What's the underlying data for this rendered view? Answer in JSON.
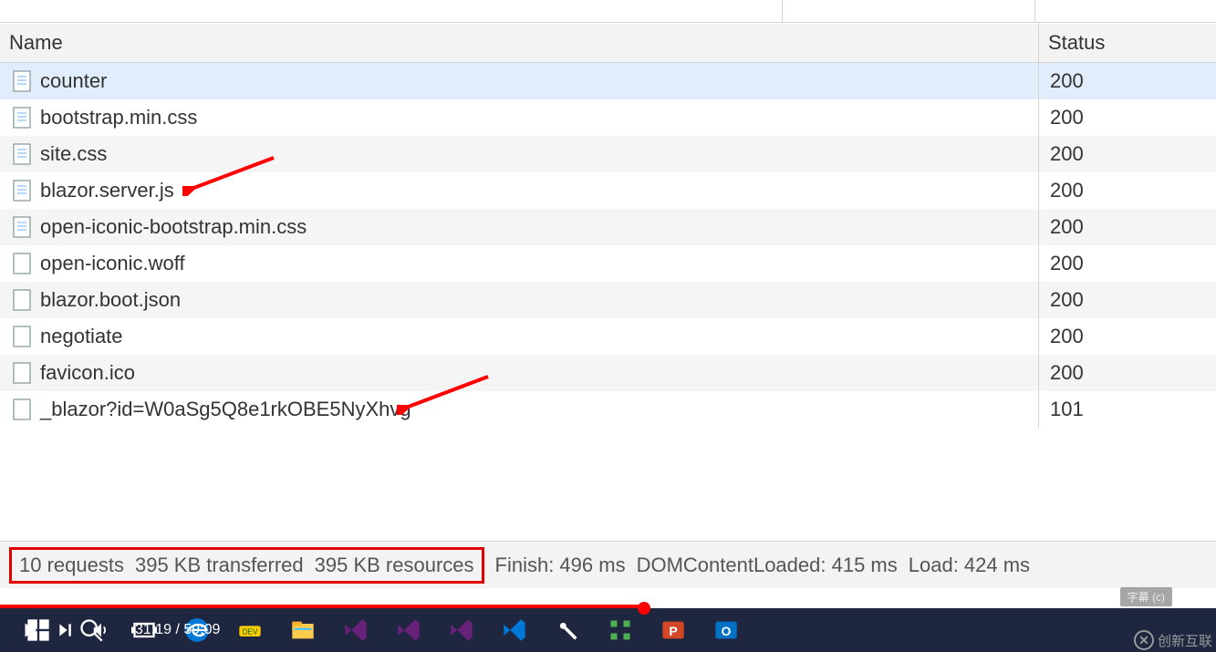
{
  "headers": {
    "name": "Name",
    "status": "Status"
  },
  "rows": [
    {
      "name": "counter",
      "status": "200",
      "iconType": "doc",
      "selected": true
    },
    {
      "name": "bootstrap.min.css",
      "status": "200",
      "iconType": "doc"
    },
    {
      "name": "site.css",
      "status": "200",
      "iconType": "doc",
      "alt": true
    },
    {
      "name": "blazor.server.js",
      "status": "200",
      "iconType": "doc",
      "arrow": true,
      "arrowX": 200
    },
    {
      "name": "open-iconic-bootstrap.min.css",
      "status": "200",
      "iconType": "doc",
      "alt": true
    },
    {
      "name": "open-iconic.woff",
      "status": "200",
      "iconType": "blank"
    },
    {
      "name": "blazor.boot.json",
      "status": "200",
      "iconType": "blank",
      "alt": true
    },
    {
      "name": "negotiate",
      "status": "200",
      "iconType": "blank"
    },
    {
      "name": "favicon.ico",
      "status": "200",
      "iconType": "blank",
      "alt": true
    },
    {
      "name": "_blazor?id=W0aSg5Q8e1rkOBE5NyXhvg",
      "status": "101",
      "iconType": "blank",
      "arrow": true,
      "arrowX": 435
    }
  ],
  "summary": {
    "requests": "10 requests",
    "transferred": "395 KB transferred",
    "resources": "395 KB resources",
    "finish": "Finish: 496 ms",
    "dcl": "DOMContentLoaded: 415 ms",
    "load": "Load: 424 ms"
  },
  "video": {
    "time": "31:19 / 59:09"
  },
  "subtitle_badge": "字幕 (c)",
  "watermark": "创新互联"
}
